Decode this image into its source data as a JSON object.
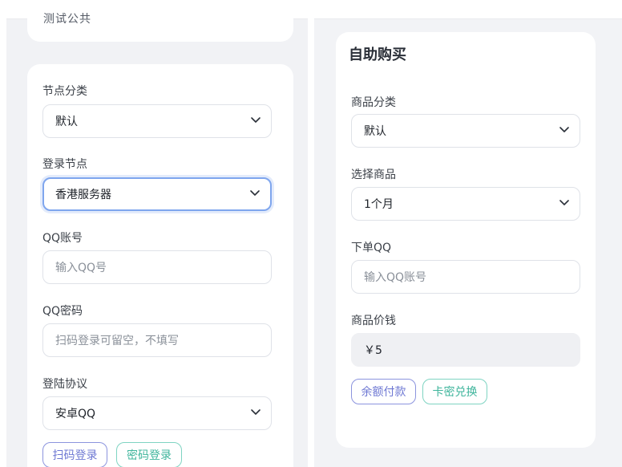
{
  "left": {
    "top_card_cut_text": "测试公共",
    "node_category": {
      "label": "节点分类",
      "value": "默认"
    },
    "login_node": {
      "label": "登录节点",
      "value": "香港服务器"
    },
    "qq_account": {
      "label": "QQ账号",
      "placeholder": "输入QQ号"
    },
    "qq_password": {
      "label": "QQ密码",
      "placeholder": "扫码登录可留空，不填写"
    },
    "login_protocol": {
      "label": "登陆协议",
      "value": "安卓QQ"
    },
    "buttons": {
      "scan_login": "扫码登录",
      "password_login": "密码登录"
    }
  },
  "right": {
    "title": "自助购买",
    "product_category": {
      "label": "商品分类",
      "value": "默认"
    },
    "select_product": {
      "label": "选择商品",
      "value": "1个月"
    },
    "order_qq": {
      "label": "下单QQ",
      "placeholder": "输入QQ账号"
    },
    "price": {
      "label": "商品价钱",
      "value": "￥5"
    },
    "buttons": {
      "balance_pay": "余额付款",
      "card_redeem": "卡密兑换"
    }
  },
  "colors": {
    "accent_purple": "#6e78d3",
    "accent_teal": "#3fb59c",
    "focus_border": "#7fa6ee"
  }
}
